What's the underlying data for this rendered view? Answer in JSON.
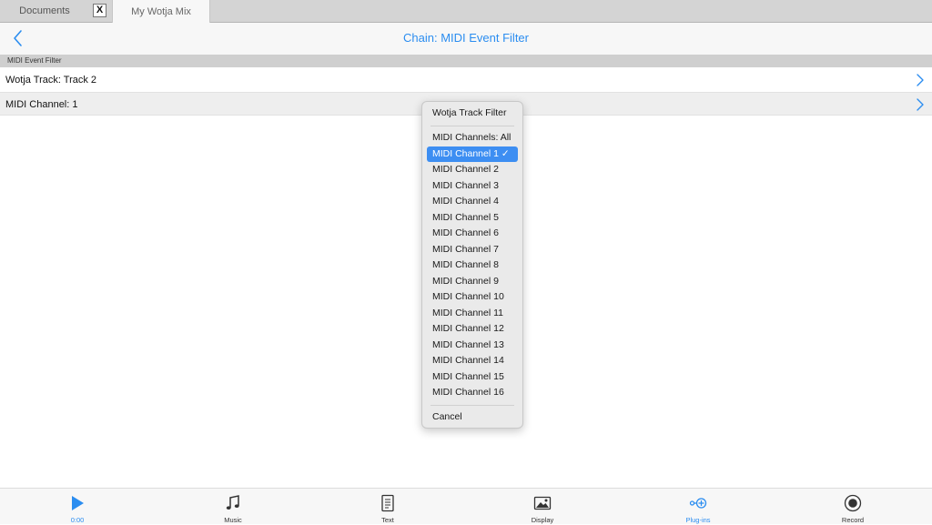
{
  "tabs": {
    "documents_label": "Documents",
    "close_label": "X",
    "active_label": "My Wotja Mix"
  },
  "header": {
    "title": "Chain: MIDI Event Filter"
  },
  "section": {
    "title": "MIDI Event Filter"
  },
  "rows": [
    {
      "label": "Wotja Track: Track 2"
    },
    {
      "label": "MIDI Channel: 1"
    }
  ],
  "menu": {
    "title": "Wotja Track Filter",
    "items": [
      "MIDI Channels: All",
      "MIDI Channel 1 ✓",
      "MIDI Channel 2",
      "MIDI Channel 3",
      "MIDI Channel 4",
      "MIDI Channel 5",
      "MIDI Channel 6",
      "MIDI Channel 7",
      "MIDI Channel 8",
      "MIDI Channel 9",
      "MIDI Channel 10",
      "MIDI Channel 11",
      "MIDI Channel 12",
      "MIDI Channel 13",
      "MIDI Channel 14",
      "MIDI Channel 15",
      "MIDI Channel 16"
    ],
    "selected": "MIDI Channel 1",
    "cancel_label": "Cancel"
  },
  "toolbar": {
    "items": [
      {
        "label": "0:00",
        "icon": "play-icon",
        "active": true
      },
      {
        "label": "Music",
        "icon": "music-note-icon"
      },
      {
        "label": "Text",
        "icon": "document-icon"
      },
      {
        "label": "Display",
        "icon": "image-icon"
      },
      {
        "label": "Plug-ins",
        "icon": "plugin-icon",
        "active": true
      },
      {
        "label": "Record",
        "icon": "record-icon"
      }
    ]
  },
  "colors": {
    "accent": "#2b8df0",
    "selection": "#3d8ef2"
  }
}
